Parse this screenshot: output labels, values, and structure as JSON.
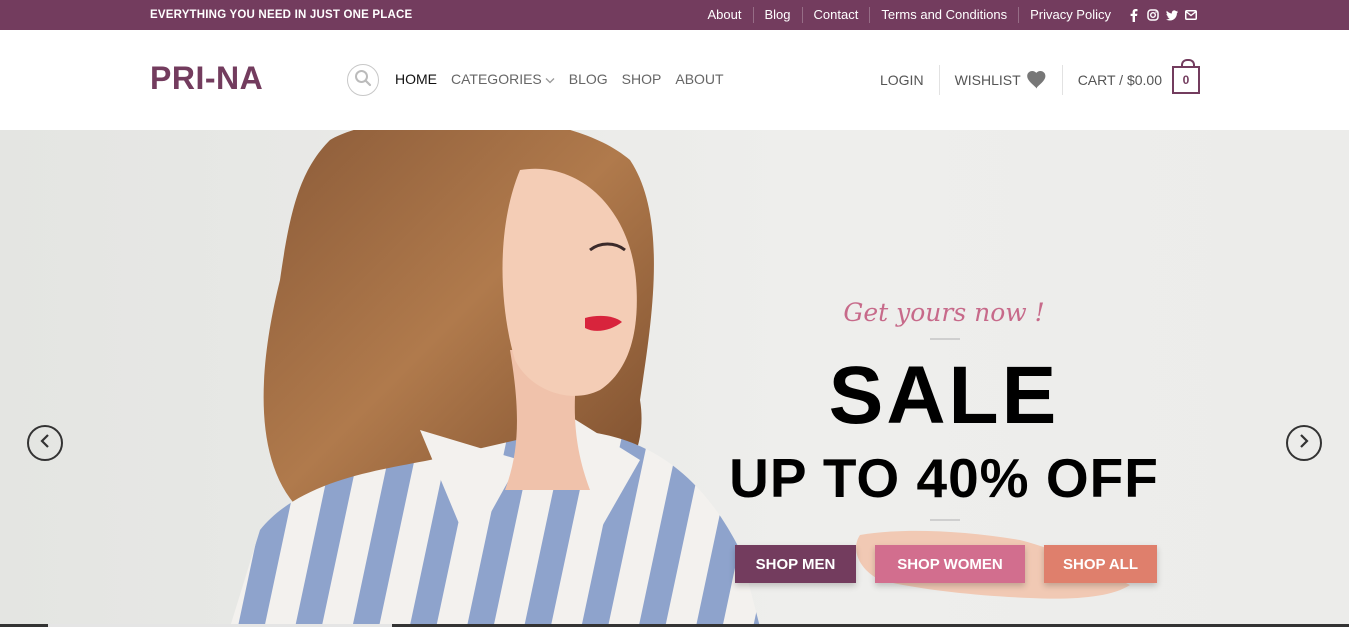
{
  "topbar": {
    "tagline": "EVERYTHING YOU NEED IN JUST ONE PLACE",
    "links": [
      "About",
      "Blog",
      "Contact",
      "Terms and Conditions",
      "Privacy Policy"
    ],
    "social_icons": [
      "facebook-icon",
      "instagram-icon",
      "twitter-icon",
      "email-icon"
    ]
  },
  "header": {
    "logo": "PRI-NA",
    "nav": [
      "HOME",
      "CATEGORIES",
      "BLOG",
      "SHOP",
      "ABOUT"
    ],
    "login": "LOGIN",
    "wishlist": "WISHLIST",
    "cart": "CART / $0.00",
    "cart_count": "0"
  },
  "hero": {
    "kicker": "Get yours now !",
    "headline": "SALE",
    "subheadline": "UP TO 40% OFF",
    "buttons": [
      "SHOP MEN",
      "SHOP WOMEN",
      "SHOP ALL"
    ]
  },
  "colors": {
    "brand": "#733c5e",
    "pink": "#d26e8e",
    "coral": "#df7f6c",
    "script": "#c76a8a"
  }
}
